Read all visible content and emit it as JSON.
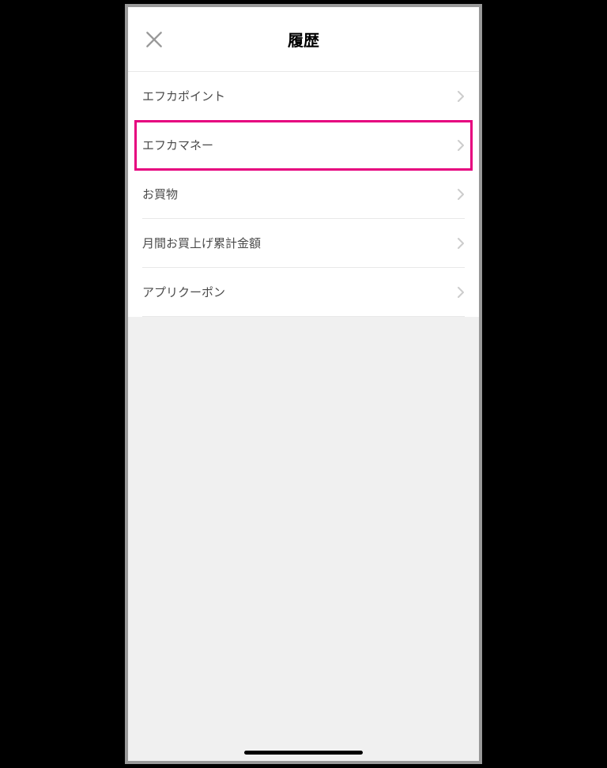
{
  "header": {
    "title": "履歴"
  },
  "menu": {
    "items": [
      {
        "label": "エフカポイント",
        "highlighted": false
      },
      {
        "label": "エフカマネー",
        "highlighted": true
      },
      {
        "label": "お買物",
        "highlighted": false
      },
      {
        "label": "月間お買上げ累計金額",
        "highlighted": false
      },
      {
        "label": "アプリクーポン",
        "highlighted": false
      }
    ]
  }
}
